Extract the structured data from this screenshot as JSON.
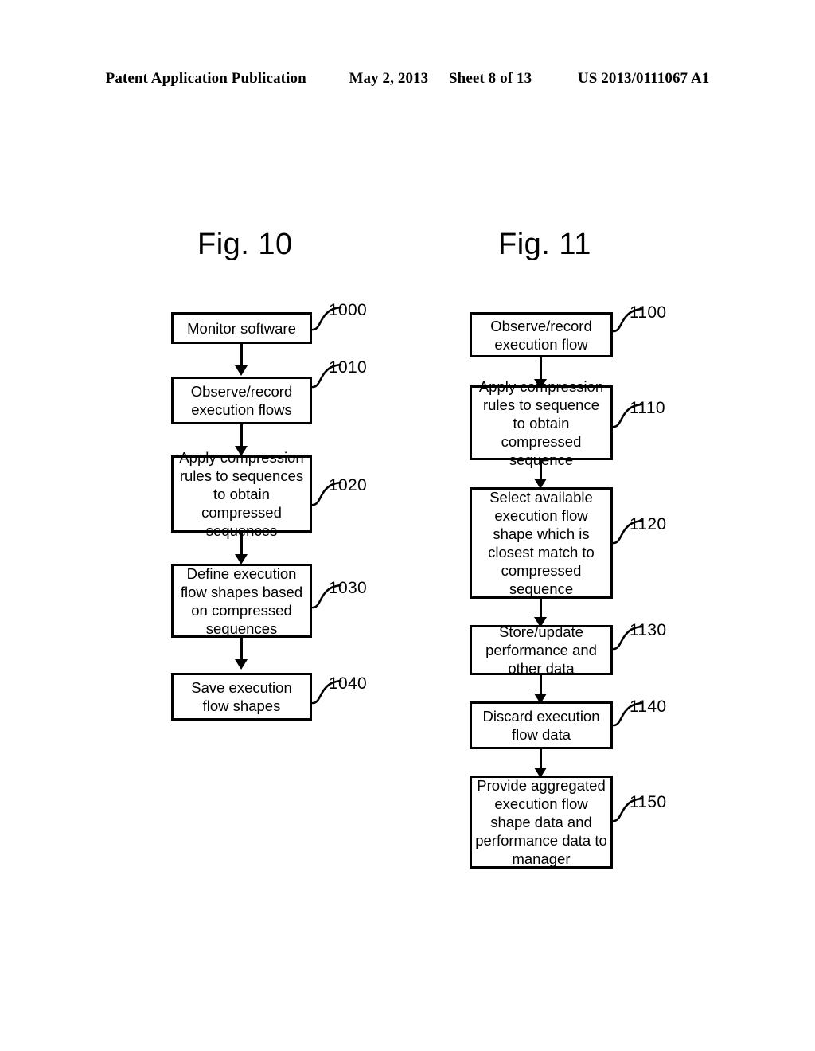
{
  "header": {
    "publication": "Patent Application Publication",
    "date": "May 2, 2013",
    "sheet": "Sheet 8 of 13",
    "docnum": "US 2013/0111067 A1"
  },
  "figures": [
    {
      "title": "Fig. 10",
      "steps": [
        {
          "ref": "1000",
          "text": "Monitor software"
        },
        {
          "ref": "1010",
          "text": "Observe/record execution flows"
        },
        {
          "ref": "1020",
          "text": "Apply compression rules to sequences to obtain compressed sequences"
        },
        {
          "ref": "1030",
          "text": "Define execution flow shapes based on compressed sequences"
        },
        {
          "ref": "1040",
          "text": "Save execution flow shapes"
        }
      ]
    },
    {
      "title": "Fig. 11",
      "steps": [
        {
          "ref": "1100",
          "text": "Observe/record execution flow"
        },
        {
          "ref": "1110",
          "text": "Apply compression rules to sequence to obtain compressed sequence"
        },
        {
          "ref": "1120",
          "text": "Select available execution flow shape which is closest match to compressed sequence"
        },
        {
          "ref": "1130",
          "text": "Store/update performance and other data"
        },
        {
          "ref": "1140",
          "text": "Discard execution flow data"
        },
        {
          "ref": "1150",
          "text": "Provide aggregated execution flow shape data and performance data to manager"
        }
      ]
    }
  ]
}
